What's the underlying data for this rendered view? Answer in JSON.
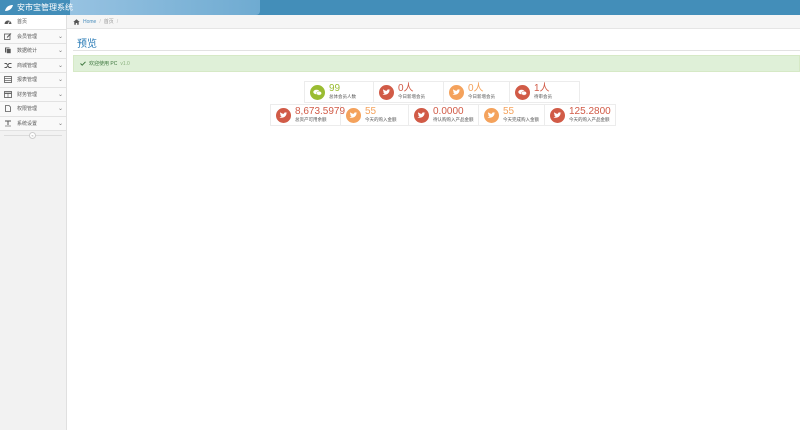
{
  "app": {
    "title": "安市宝管理系统",
    "brand_color": "#438eb9"
  },
  "sidebar": {
    "items": [
      {
        "label": "首页",
        "icon": "dashboard-icon",
        "active": true,
        "has_arrow": false
      },
      {
        "label": "会员管理",
        "icon": "edit-icon",
        "active": false,
        "has_arrow": true
      },
      {
        "label": "数据统计",
        "icon": "files-icon",
        "active": false,
        "has_arrow": true
      },
      {
        "label": "商城管理",
        "icon": "shuffle-icon",
        "active": false,
        "has_arrow": true
      },
      {
        "label": "报表管理",
        "icon": "list-icon",
        "active": false,
        "has_arrow": true
      },
      {
        "label": "财务管理",
        "icon": "table-icon",
        "active": false,
        "has_arrow": true
      },
      {
        "label": "权限管理",
        "icon": "document-icon",
        "active": false,
        "has_arrow": true
      },
      {
        "label": "系统设置",
        "icon": "text-width-icon",
        "active": false,
        "has_arrow": true
      }
    ]
  },
  "breadcrumbs": {
    "home": "Home",
    "current": "首页"
  },
  "page": {
    "title": "预览"
  },
  "alert": {
    "text": "欢迎使用 PC",
    "version": "v1.0"
  },
  "stats_row1": [
    {
      "value": "99",
      "label": "总体会员人数",
      "color": "#9abc32",
      "icon": "comments-icon"
    },
    {
      "value": "0人",
      "label": "今日新增会员",
      "color": "#d15b47",
      "icon": "twitter-icon"
    },
    {
      "value": "0人",
      "label": "今日新增会员",
      "color": "#f4a25c",
      "icon": "twitter-icon"
    },
    {
      "value": "1人",
      "label": "待审会员",
      "color": "#d15b47",
      "icon": "comments-icon"
    }
  ],
  "stats_row2": [
    {
      "value": "8,673.5979",
      "label": "总资产可用余额",
      "color": "#d15b47",
      "icon": "twitter-icon"
    },
    {
      "value": "55",
      "label": "今天的购入金额",
      "color": "#f4a25c",
      "icon": "twitter-icon"
    },
    {
      "value": "0.0000",
      "label": "待认购购入产品金额",
      "color": "#d15b47",
      "icon": "twitter-icon"
    },
    {
      "value": "55",
      "label": "今天完成购入金额",
      "color": "#f4a25c",
      "icon": "twitter-icon"
    },
    {
      "value": "125.2800",
      "label": "今天的购入产品金额",
      "color": "#d15b47",
      "icon": "twitter-icon"
    }
  ]
}
